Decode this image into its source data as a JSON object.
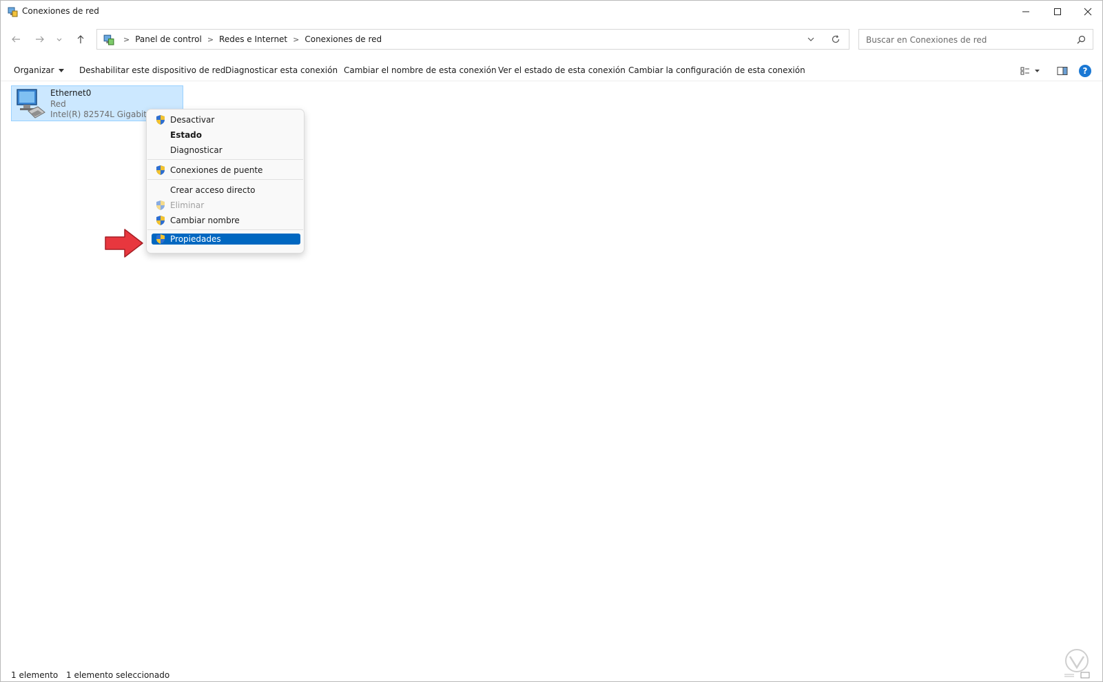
{
  "window": {
    "title": "Conexiones de red"
  },
  "nav": {
    "breadcrumb": [
      "Panel de control",
      "Redes e Internet",
      "Conexiones de red"
    ],
    "search_placeholder": "Buscar en Conexiones de red"
  },
  "cmdbar": {
    "organize": "Organizar",
    "disable": "Deshabilitar este dispositivo de red",
    "diagnose": "Diagnosticar esta conexión",
    "rename": "Cambiar el nombre de esta conexión",
    "status": "Ver el estado de esta conexión",
    "settings": "Cambiar la configuración de esta conexión",
    "help": "?"
  },
  "item": {
    "name": "Ethernet0",
    "type": "Red",
    "device": "Intel(R) 82574L Gigabit Net"
  },
  "context_menu": {
    "items": [
      {
        "label": "Desactivar",
        "shield": true
      },
      {
        "label": "Estado",
        "bold": true
      },
      {
        "label": "Diagnosticar"
      },
      {
        "label": "Conexiones de puente",
        "shield": true
      },
      {
        "label": "Crear acceso directo"
      },
      {
        "label": "Eliminar",
        "shield": true,
        "disabled": true
      },
      {
        "label": "Cambiar nombre",
        "shield": true
      },
      {
        "label": "Propiedades",
        "shield": true,
        "selected": true
      }
    ]
  },
  "statusbar": {
    "count": "1 elemento",
    "selected": "1 elemento seleccionado"
  },
  "colors": {
    "selection_bg": "#cce8ff",
    "menu_highlight": "#0067c0",
    "arrow": "#e8373e",
    "accent": "#1a78d4"
  }
}
